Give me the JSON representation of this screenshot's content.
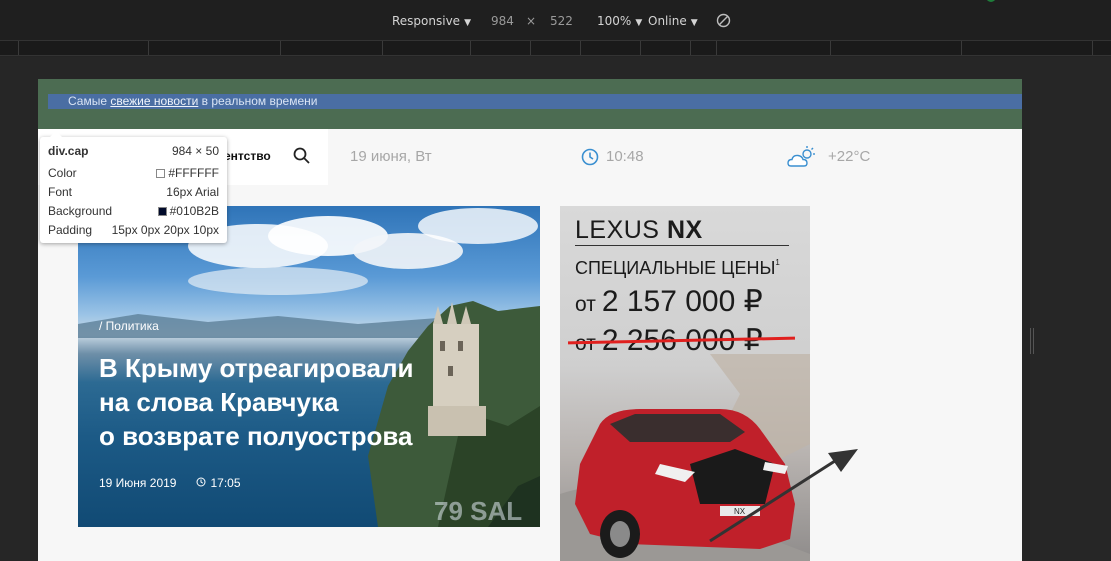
{
  "devtools": {
    "device": "Responsive",
    "width": "984",
    "times": "×",
    "height": "522",
    "zoom": "100%",
    "network": "Online"
  },
  "cap": {
    "text_before": "Самые ",
    "link": "свежие новости",
    "text_after": " в реальном времени"
  },
  "navbar": {
    "partial_item": "ентство",
    "date": "19 июня, Вт",
    "time": "10:48",
    "temperature": "+22°C"
  },
  "hero": {
    "category": "/ Политика",
    "title_line1": "В Крыму отреагировали",
    "title_line2": "на слова Кравчука",
    "title_line3": "о возврате полуострова",
    "date": "19 Июня 2019",
    "time": "17:05"
  },
  "ad": {
    "brand_light": "LEXUS ",
    "brand_bold": "NX",
    "offer": "СПЕЦИАЛЬНЫЕ ЦЕНЫ",
    "footnote": "1",
    "from": "от",
    "price": "2 157 000 ₽",
    "old_price": "2 256 000 ₽",
    "plate": "NX"
  },
  "inspector": {
    "selector": "div.cap",
    "size": "984 × 50",
    "color_label": "Color",
    "color_value": "#FFFFFF",
    "font_label": "Font",
    "font_value": "16px Arial",
    "background_label": "Background",
    "background_value": "#010B2B",
    "padding_label": "Padding",
    "padding_value": "15px 0px 20px 10px"
  },
  "colors": {
    "cap_bg_highlight": "#4c6c52",
    "cap_content_highlight": "#4a6ea3",
    "ad_strike": "#e0201e",
    "icon_blue": "#3a8fd0"
  }
}
